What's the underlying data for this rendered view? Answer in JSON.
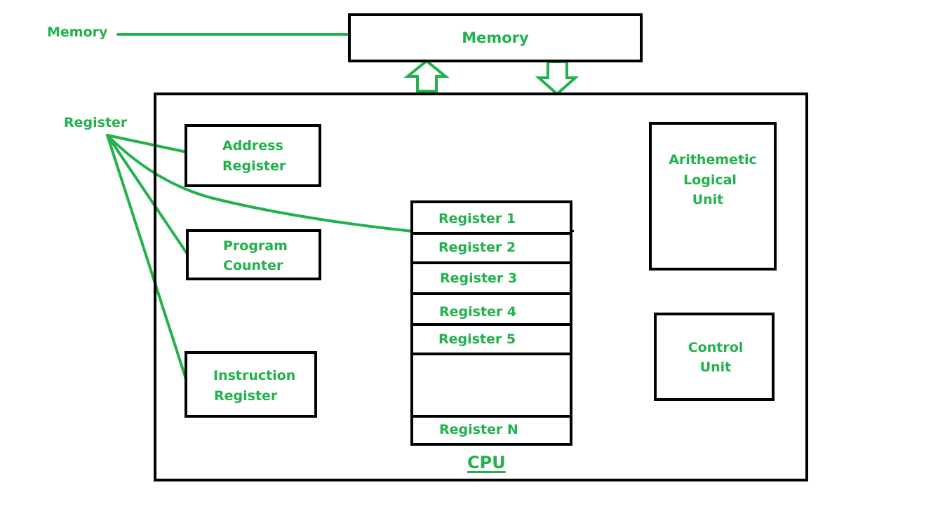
{
  "diagram": {
    "colors": {
      "accent": "#22b14c",
      "stroke": "#000000",
      "background": "#ffffff"
    },
    "annotations": {
      "memory_label": "Memory",
      "register_label": "Register"
    },
    "memory": {
      "title": "Memory",
      "arrows": [
        {
          "direction": "up",
          "meaning": "cpu-to-memory"
        },
        {
          "direction": "down",
          "meaning": "memory-to-cpu"
        }
      ]
    },
    "cpu": {
      "title": "CPU",
      "address_register": {
        "line1": "Address",
        "line2": "Register"
      },
      "program_counter": {
        "line1": "Program",
        "line2": "Counter"
      },
      "instruction_register": {
        "line1": "Instruction",
        "line2": "Register"
      },
      "alu": {
        "line1": "Arithemetic",
        "line2": "Logical",
        "line3": "Unit"
      },
      "control_unit": {
        "line1": "Control",
        "line2": "Unit"
      },
      "register_file": [
        "Register 1",
        "Register 2",
        "Register 3",
        "Register 4",
        "Register 5",
        "",
        "Register N"
      ]
    }
  }
}
